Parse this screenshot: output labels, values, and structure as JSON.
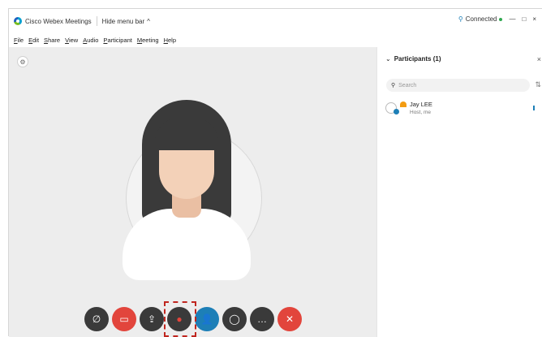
{
  "titlebar": {
    "app_title": "Cisco Webex Meetings",
    "hide_menu_bar": "Hide menu bar",
    "connection": "Connected",
    "minimize": "—",
    "maximize": "□",
    "close": "×"
  },
  "menu": [
    "File",
    "Edit",
    "Share",
    "View",
    "Audio",
    "Participant",
    "Meeting",
    "Help"
  ],
  "participants": {
    "header": "Participants (1)",
    "search_placeholder": "Search",
    "list": [
      {
        "name": "Jay LEE",
        "role": "Host, me"
      }
    ]
  },
  "toolbar_icons": [
    {
      "name": "mute",
      "color": "#3a3a3a"
    },
    {
      "name": "stop-video",
      "color": "#e2453c"
    },
    {
      "name": "share",
      "color": "#3a3a3a"
    },
    {
      "name": "record",
      "color": "#3a3a3a"
    },
    {
      "name": "participants",
      "color": "#1d7fb7"
    },
    {
      "name": "chat",
      "color": "#3a3a3a"
    },
    {
      "name": "more",
      "color": "#3a3a3a"
    },
    {
      "name": "end-meeting",
      "color": "#e2453c"
    }
  ],
  "accent_color": "#1d7fb7"
}
